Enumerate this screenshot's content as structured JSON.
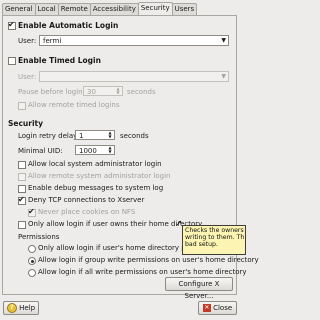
{
  "tabs": [
    "General",
    "Local",
    "Remote",
    "Accessibility",
    "Security",
    "Users"
  ],
  "auto_login": {
    "label": "Enable Automatic Login",
    "user_label": "User:",
    "user_value": "fermi"
  },
  "timed_login": {
    "label": "Enable Timed Login",
    "user_label": "User:",
    "pause_label": "Pause before login:",
    "pause_value": "30",
    "pause_unit": "seconds",
    "allow_remote": "Allow remote timed logins"
  },
  "security": {
    "heading": "Security",
    "retry_label": "Login retry delay:",
    "retry_value": "1",
    "retry_unit": "seconds",
    "uid_label": "Minimal UID:",
    "uid_value": "1000",
    "options": [
      {
        "label": "Allow local system administrator login",
        "checked": false,
        "disabled": false
      },
      {
        "label": "Allow remote system administrator login",
        "checked": false,
        "disabled": true
      },
      {
        "label": "Enable debug messages to system log",
        "checked": false,
        "disabled": false
      },
      {
        "label": "Deny TCP connections to Xserver",
        "checked": true,
        "disabled": false
      },
      {
        "label": "Never place cookies on NFS",
        "checked": true,
        "disabled": true
      },
      {
        "label": "Only allow login if user owns their home directory",
        "checked": false,
        "disabled": false
      }
    ]
  },
  "permissions": {
    "heading": "Permissions",
    "radios": [
      {
        "label": "Only allow login if user's home directory permissions",
        "checked": false
      },
      {
        "label": "Allow login if group write permissions on user's home directory",
        "checked": true
      },
      {
        "label": "Allow login if all write permissions on user's home directory",
        "checked": false
      }
    ]
  },
  "tooltip": {
    "lines": [
      "Checks the owners",
      "writing to them. Th",
      "bad setup."
    ]
  },
  "buttons": {
    "configure": "Configure X Server...",
    "help": "Help",
    "close": "Close"
  }
}
